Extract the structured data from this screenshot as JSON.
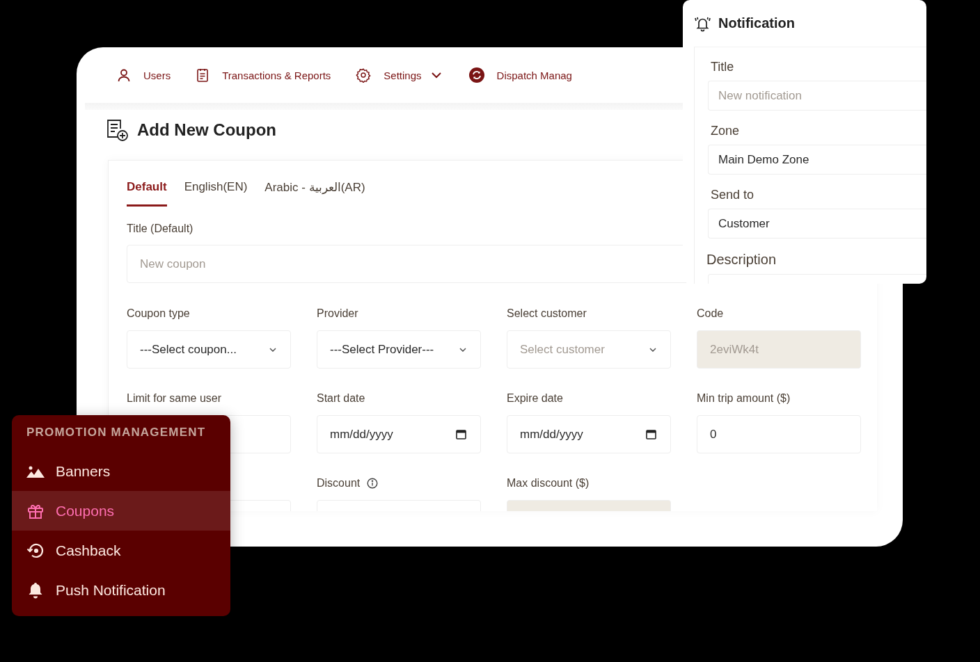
{
  "nav": [
    {
      "kind": "user",
      "label": "Users"
    },
    {
      "kind": "report",
      "label": "Transactions & Reports"
    },
    {
      "kind": "settings",
      "label": "Settings",
      "dropdown": true
    },
    {
      "kind": "dispatch",
      "label": "Dispatch Manag"
    }
  ],
  "page_title": "Add New Coupon",
  "tabs": [
    {
      "label": "Default",
      "selected": true
    },
    {
      "label": "English(EN)",
      "selected": false
    },
    {
      "label": "Arabic - العربية(AR)",
      "selected": false
    }
  ],
  "title_field": {
    "label": "Title (Default)",
    "placeholder": "New coupon"
  },
  "fields": [
    {
      "label": "Coupon type",
      "kind": "select",
      "value": "---Select coupon...",
      "disabled": false
    },
    {
      "label": "Provider",
      "kind": "select",
      "value": "---Select Provider---",
      "disabled": false
    },
    {
      "label": "Select customer",
      "kind": "select",
      "placeholder": "Select customer",
      "disabled": false
    },
    {
      "label": "Code",
      "kind": "text",
      "value": "2eviWk4t",
      "disabled": true
    },
    {
      "label": "Limit for same user",
      "kind": "text",
      "disabled": false
    },
    {
      "label": "Start date",
      "kind": "date",
      "value": "mm/dd/yyyy",
      "disabled": false
    },
    {
      "label": "Expire date",
      "kind": "date",
      "value": "mm/dd/yyyy",
      "disabled": false
    },
    {
      "label": "Min trip amount ($)",
      "kind": "text",
      "value": "0",
      "disabled": false
    },
    {
      "kind": "text",
      "disabled": false
    },
    {
      "label": "Discount",
      "kind": "text",
      "info": true,
      "disabled": false
    },
    {
      "label": "Max discount ($)",
      "kind": "text",
      "disabled": true
    }
  ],
  "notification": {
    "title": "Notification",
    "fields": [
      {
        "label": "Title",
        "placeholder": "New notification"
      },
      {
        "label": "Zone",
        "value": "Main Demo Zone"
      },
      {
        "label": "Send to",
        "value": "Customer"
      },
      {
        "label": "Description",
        "large": true
      }
    ]
  },
  "promo_menu": {
    "heading": "PROMOTION MANAGEMENT",
    "items": [
      {
        "kind": "banner",
        "label": "Banners",
        "selected": false
      },
      {
        "kind": "gift",
        "label": "Coupons",
        "selected": true
      },
      {
        "kind": "cashback",
        "label": "Cashback",
        "selected": false
      },
      {
        "kind": "bell",
        "label": "Push Notification",
        "selected": false
      }
    ]
  }
}
